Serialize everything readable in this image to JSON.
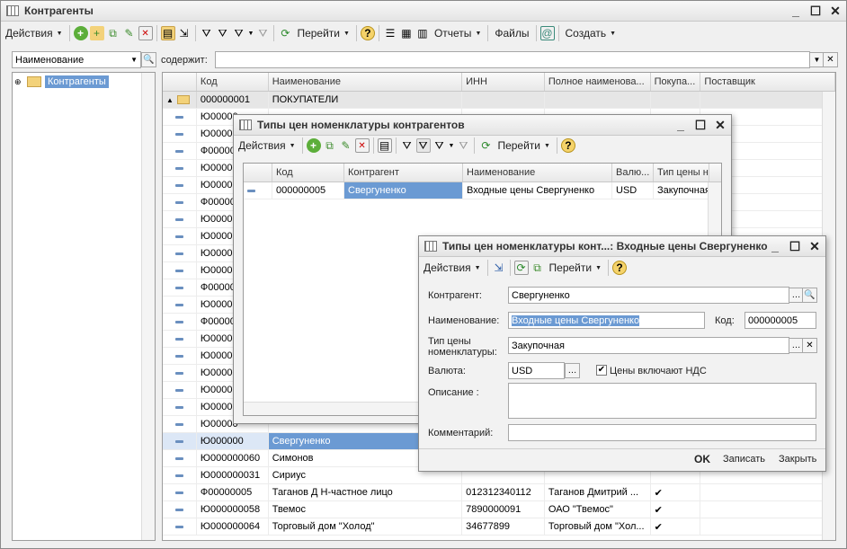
{
  "main": {
    "title": "Контрагенты",
    "toolbar": {
      "actions": "Действия",
      "go": "Перейти",
      "reports": "Отчеты",
      "files": "Файлы",
      "create": "Создать"
    },
    "search": {
      "field": "Наименование",
      "contains_label": "содержит:",
      "value": ""
    },
    "tree": {
      "root": "Контрагенты"
    },
    "columns": [
      "Код",
      "Наименование",
      "ИНН",
      "Полное наименова...",
      "Покупа...",
      "Поставщик"
    ],
    "group_row": {
      "code": "000000001",
      "name": "ПОКУПАТЕЛИ"
    },
    "rows": [
      {
        "code": "Ю00000",
        "name": "",
        "inn": "",
        "full": "",
        "buyer": ""
      },
      {
        "code": "Ю00000",
        "name": "",
        "inn": "",
        "full": "",
        "buyer": ""
      },
      {
        "code": "Ф00000",
        "name": "",
        "inn": "",
        "full": "",
        "buyer": ""
      },
      {
        "code": "Ю00000",
        "name": "",
        "inn": "",
        "full": "",
        "buyer": ""
      },
      {
        "code": "Ю00000",
        "name": "",
        "inn": "",
        "full": "",
        "buyer": ""
      },
      {
        "code": "Ф00000",
        "name": "",
        "inn": "",
        "full": "",
        "buyer": ""
      },
      {
        "code": "Ю00000",
        "name": "",
        "inn": "",
        "full": "",
        "buyer": ""
      },
      {
        "code": "Ю00000",
        "name": "",
        "inn": "",
        "full": "",
        "buyer": ""
      },
      {
        "code": "Ю00000",
        "name": "",
        "inn": "",
        "full": "",
        "buyer": ""
      },
      {
        "code": "Ю00000",
        "name": "",
        "inn": "",
        "full": "",
        "buyer": ""
      },
      {
        "code": "Ф00000",
        "name": "",
        "inn": "",
        "full": "",
        "buyer": ""
      },
      {
        "code": "Ю00000",
        "name": "",
        "inn": "",
        "full": "",
        "buyer": ""
      },
      {
        "code": "Ф00000",
        "name": "",
        "inn": "",
        "full": "",
        "buyer": ""
      },
      {
        "code": "Ю00000",
        "name": "",
        "inn": "",
        "full": "",
        "buyer": ""
      },
      {
        "code": "Ю00000",
        "name": "",
        "inn": "",
        "full": "",
        "buyer": ""
      },
      {
        "code": "Ю00000",
        "name": "",
        "inn": "",
        "full": "",
        "buyer": ""
      },
      {
        "code": "Ю00000",
        "name": "",
        "inn": "",
        "full": "",
        "buyer": ""
      },
      {
        "code": "Ю00000",
        "name": "",
        "inn": "",
        "full": "",
        "buyer": ""
      },
      {
        "code": "Ю00000",
        "name": "",
        "inn": "",
        "full": "",
        "buyer": ""
      },
      {
        "code": "Ю000000",
        "name": "Свергуненко",
        "inn": "",
        "full": "",
        "buyer": ""
      },
      {
        "code": "Ю000000060",
        "name": "Симонов",
        "inn": "",
        "full": "",
        "buyer": ""
      },
      {
        "code": "Ю000000031",
        "name": "Сириус",
        "inn": "",
        "full": "",
        "buyer": ""
      },
      {
        "code": "Ф00000005",
        "name": "Таганов Д Н-частное лицо",
        "inn": "012312340112",
        "full": "Таганов Дмитрий ...",
        "buyer": "✔"
      },
      {
        "code": "Ю000000058",
        "name": "Твемос",
        "inn": "7890000091",
        "full": "ОАО \"Твемос\"",
        "buyer": "✔"
      },
      {
        "code": "Ю000000064",
        "name": "Торговый дом \"Холод\"",
        "inn": "34677899",
        "full": "Торговый дом \"Хол...",
        "buyer": "✔"
      }
    ]
  },
  "price_types": {
    "title": "Типы цен номенклатуры контрагентов",
    "toolbar": {
      "actions": "Действия",
      "go": "Перейти"
    },
    "columns": [
      "Код",
      "Контрагент",
      "Наименование",
      "Валю...",
      "Тип цены н"
    ],
    "rows": [
      {
        "code": "000000005",
        "counterparty": "Свергуненко",
        "name": "Входные цены Свергуненко",
        "currency": "USD",
        "type": "Закупочная"
      }
    ]
  },
  "form": {
    "title": "Типы цен номенклатуры конт...: Входные цены Свергуненко",
    "toolbar": {
      "actions": "Действия",
      "go": "Перейти"
    },
    "counterparty_label": "Контрагент:",
    "counterparty": "Свергуненко",
    "name_label": "Наименование:",
    "name": "Входные цены Свергуненко",
    "code_label": "Код:",
    "code": "000000005",
    "pricetype_label": "Тип цены номенклатуры:",
    "pricetype": "Закупочная",
    "currency_label": "Валюта:",
    "currency": "USD",
    "vat_label": "Цены включают НДС",
    "description_label": "Описание :",
    "description": "",
    "comment_label": "Комментарий:",
    "comment": "",
    "ok": "OK",
    "save": "Записать",
    "close": "Закрыть"
  }
}
